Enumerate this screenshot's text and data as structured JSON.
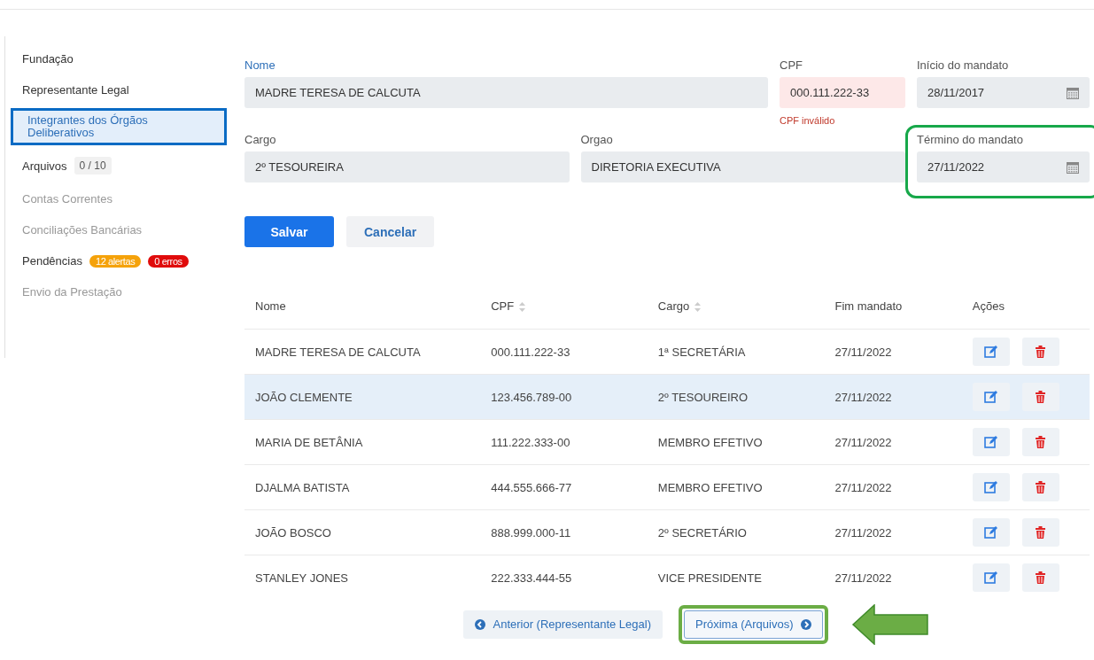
{
  "sidebar": {
    "items": [
      {
        "label": "Fundação",
        "selected": false,
        "disabled": false,
        "highlighted": false
      },
      {
        "label": "Representante Legal",
        "selected": false,
        "disabled": false,
        "highlighted": false
      },
      {
        "label": "Integrantes dos Órgãos Deliberativos",
        "selected": true,
        "disabled": false,
        "highlighted": true
      },
      {
        "label": "Arquivos",
        "selected": false,
        "disabled": false,
        "highlighted": false,
        "count": "0 / 10"
      },
      {
        "label": "Contas Correntes",
        "selected": false,
        "disabled": true,
        "highlighted": false
      },
      {
        "label": "Conciliações Bancárias",
        "selected": false,
        "disabled": true,
        "highlighted": false
      },
      {
        "label": "Pendências",
        "selected": false,
        "disabled": false,
        "highlighted": false,
        "badges": [
          {
            "text": "12 alertas",
            "color": "#f5a20a"
          },
          {
            "text": "0 erros",
            "color": "#e00b0b"
          }
        ]
      },
      {
        "label": "Envio da Prestação",
        "selected": false,
        "disabled": true,
        "highlighted": false
      }
    ]
  },
  "form": {
    "rows": [
      [
        {
          "label": "Nome",
          "value": "MADRE TERESA DE CALCUTA",
          "kind": "text",
          "focused": true,
          "invalid": false,
          "highlighted": false
        },
        {
          "label": "CPF",
          "value": "000.111.222-33",
          "kind": "text",
          "focused": false,
          "invalid": true,
          "error": "CPF inválido",
          "highlighted": false
        },
        {
          "label": "Início do mandato",
          "value": "28/11/2017",
          "kind": "date",
          "focused": false,
          "invalid": false,
          "highlighted": false
        }
      ],
      [
        {
          "label": "Cargo",
          "value": "2º TESOUREIRA",
          "kind": "text",
          "focused": false,
          "invalid": false,
          "highlighted": false
        },
        {
          "label": "Orgao",
          "value": "DIRETORIA EXECUTIVA",
          "kind": "text",
          "focused": false,
          "invalid": false,
          "highlighted": false
        },
        {
          "label": "Término do mandato",
          "value": "27/11/2022",
          "kind": "date",
          "focused": false,
          "invalid": false,
          "highlighted": true
        }
      ]
    ],
    "buttons": [
      {
        "label": "Salvar",
        "kind": "primary"
      },
      {
        "label": "Cancelar",
        "kind": "secondary"
      }
    ]
  },
  "table": {
    "columns": [
      {
        "label": "Nome",
        "sortable": false
      },
      {
        "label": "CPF",
        "sortable": true
      },
      {
        "label": "Cargo",
        "sortable": true
      },
      {
        "label": "Fim mandato",
        "sortable": false
      },
      {
        "label": "Ações",
        "sortable": false
      }
    ],
    "rows": [
      {
        "cells": [
          "MADRE TERESA DE CALCUTA",
          "000.111.222-33",
          "1ª SECRETÁRIA",
          "27/11/2022"
        ],
        "selected": false
      },
      {
        "cells": [
          "JOÃO CLEMENTE",
          "123.456.789-00",
          "2º TESOUREIRO",
          "27/11/2022"
        ],
        "selected": true
      },
      {
        "cells": [
          "MARIA DE BETÂNIA",
          "111.222.333-00",
          "MEMBRO EFETIVO",
          "27/11/2022"
        ],
        "selected": false
      },
      {
        "cells": [
          "DJALMA BATISTA",
          "444.555.666-77",
          "MEMBRO EFETIVO",
          "27/11/2022"
        ],
        "selected": false
      },
      {
        "cells": [
          "JOÃO BOSCO",
          "888.999.000-11",
          "2º SECRETÁRIO",
          "27/11/2022"
        ],
        "selected": false
      },
      {
        "cells": [
          "STANLEY JONES",
          "222.333.444-55",
          "VICE PRESIDENTE",
          "27/11/2022"
        ],
        "selected": false
      }
    ]
  },
  "navigation": {
    "previous": {
      "label": "Anterior (Representante Legal)",
      "highlighted": false
    },
    "next": {
      "label": "Próxima (Arquivos)",
      "highlighted": true,
      "pointer_arrow": true
    }
  }
}
